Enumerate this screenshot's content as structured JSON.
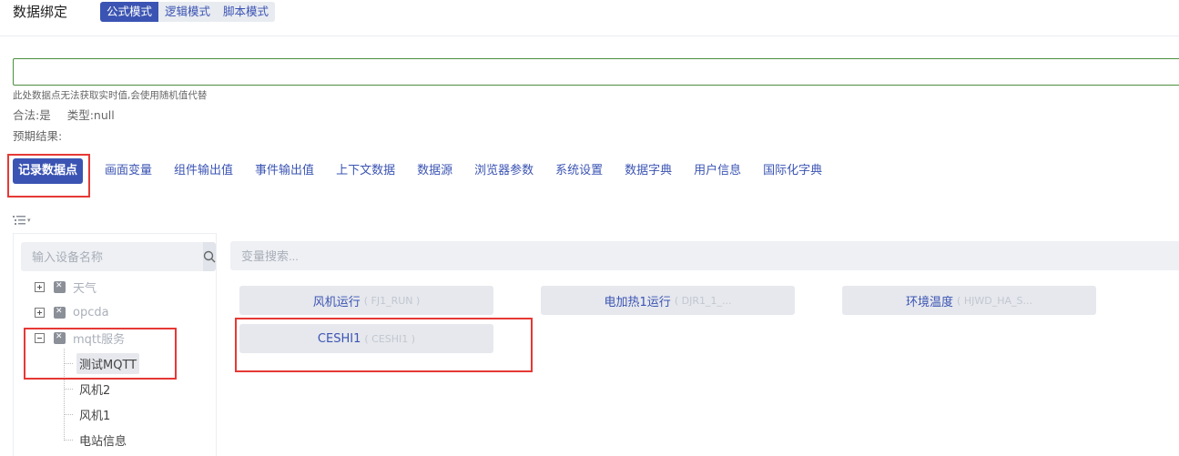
{
  "header": {
    "title": "数据绑定",
    "modes": [
      "公式模式",
      "逻辑模式",
      "脚本模式"
    ],
    "active_mode": "公式模式"
  },
  "formula": {
    "value": "",
    "hint": "此处数据点无法获取实时值,会使用随机值代替",
    "valid_label": "合法:是",
    "type_label": "类型:null",
    "expected_label": "预期结果:"
  },
  "tabs": [
    "记录数据点",
    "画面变量",
    "组件输出值",
    "事件输出值",
    "上下文数据",
    "数据源",
    "浏览器参数",
    "系统设置",
    "数据字典",
    "用户信息",
    "国际化字典"
  ],
  "device_panel": {
    "search_placeholder": "输入设备名称",
    "tree": [
      {
        "label": "天气",
        "expanded": false
      },
      {
        "label": "opcda",
        "expanded": false
      },
      {
        "label": "mqtt服务",
        "expanded": true,
        "children": [
          "测试MQTT",
          "风机2",
          "风机1",
          "电站信息"
        ]
      }
    ],
    "selected_child": "测试MQTT"
  },
  "variables": {
    "search_placeholder": "变量搜索...",
    "items": [
      {
        "name": "风机运行",
        "code": "( FJ1_RUN )"
      },
      {
        "name": "电加热1运行",
        "code": "( DJR1_1_..."
      },
      {
        "name": "环境温度",
        "code": "( HJWD_HA_S..."
      },
      {
        "name": "CESHI1",
        "code": "( CESHI1 )"
      }
    ]
  },
  "colors": {
    "accent": "#3b54b3",
    "highlight_box": "#e53935",
    "input_border": "#4c8f3f"
  },
  "icons": {
    "search": "search-icon",
    "tree_toggle": "tree-list-icon",
    "node": "device-node-icon"
  }
}
